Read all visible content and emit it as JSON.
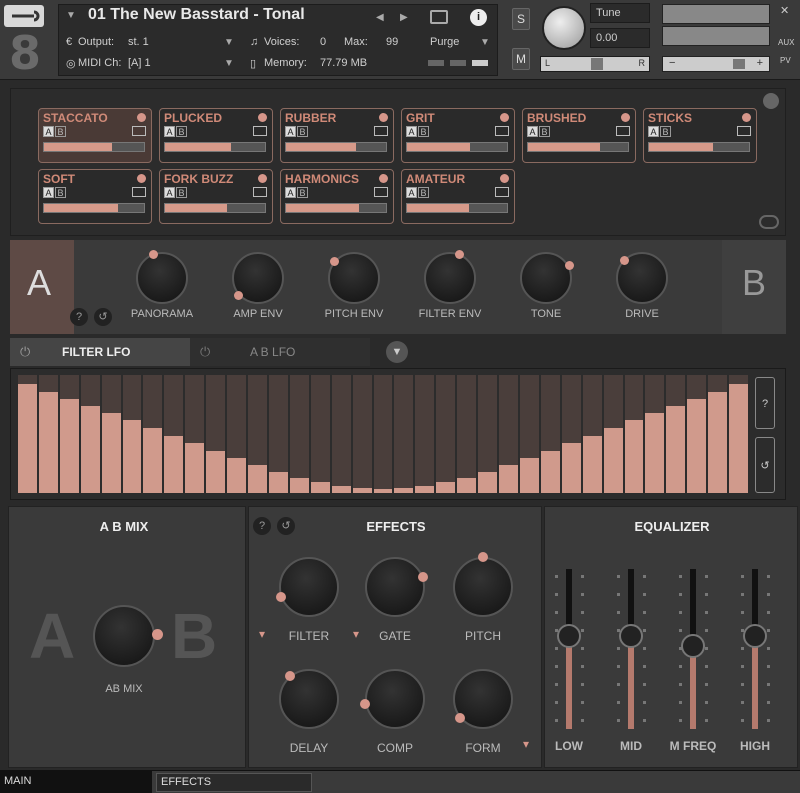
{
  "header": {
    "instrument_title": "01 The New Basstard - Tonal",
    "output_label": "Output:",
    "output_value": "st. 1",
    "voices_label": "Voices:",
    "voices_value": "0",
    "max_label": "Max:",
    "max_value": "99",
    "purge_label": "Purge",
    "midi_label": "MIDI Ch:",
    "midi_value": "[A]  1",
    "memory_label": "Memory:",
    "memory_value": "77.79 MB",
    "solo_label": "S",
    "mute_label": "M",
    "tune_label": "Tune",
    "tune_value": "0.00",
    "pan_left": "L",
    "pan_right": "R",
    "aux_label": "AUX",
    "pv_label": "PV",
    "instrument_number": "8"
  },
  "articulations": [
    {
      "name": "STACCATO",
      "fill": 0.68,
      "selected": true
    },
    {
      "name": "PLUCKED",
      "fill": 0.66
    },
    {
      "name": "RUBBER",
      "fill": 0.7
    },
    {
      "name": "GRIT",
      "fill": 0.63
    },
    {
      "name": "BRUSHED",
      "fill": 0.72
    },
    {
      "name": "STICKS",
      "fill": 0.64
    },
    {
      "name": "SOFT",
      "fill": 0.74
    },
    {
      "name": "FORK BUZZ",
      "fill": 0.62
    },
    {
      "name": "HARMONICS",
      "fill": 0.73
    },
    {
      "name": "AMATEUR",
      "fill": 0.62
    }
  ],
  "ab": {
    "a": "A",
    "b": "B"
  },
  "knobs": [
    "PANORAMA",
    "AMP ENV",
    "PITCH ENV",
    "FILTER ENV",
    "TONE",
    "DRIVE"
  ],
  "tabs": {
    "filter_lfo": "FILTER LFO",
    "ab_lfo": "A B LFO"
  },
  "lfo": {
    "values": [
      0.92,
      0.86,
      0.8,
      0.74,
      0.68,
      0.62,
      0.55,
      0.48,
      0.42,
      0.36,
      0.3,
      0.24,
      0.18,
      0.13,
      0.09,
      0.06,
      0.04,
      0.03,
      0.04,
      0.06,
      0.09,
      0.13,
      0.18,
      0.24,
      0.3,
      0.36,
      0.42,
      0.48,
      0.55,
      0.62,
      0.68,
      0.74,
      0.8,
      0.86,
      0.92
    ]
  },
  "abmix": {
    "title": "A B MIX",
    "knob_label": "AB MIX",
    "a": "A",
    "b": "B"
  },
  "effects": {
    "title": "EFFECTS",
    "knobs": [
      "FILTER",
      "GATE",
      "PITCH",
      "DELAY",
      "COMP",
      "FORM"
    ]
  },
  "equalizer": {
    "title": "EQUALIZER",
    "bands": [
      {
        "label": "LOW",
        "level": 0.58
      },
      {
        "label": "MID",
        "level": 0.58
      },
      {
        "label": "M FREQ",
        "level": 0.52
      },
      {
        "label": "HIGH",
        "level": 0.58
      }
    ]
  },
  "status": {
    "main": "MAIN",
    "effects": "EFFECTS"
  },
  "colors": {
    "accent": "#d6968a",
    "panel": "#3a3a3a"
  }
}
